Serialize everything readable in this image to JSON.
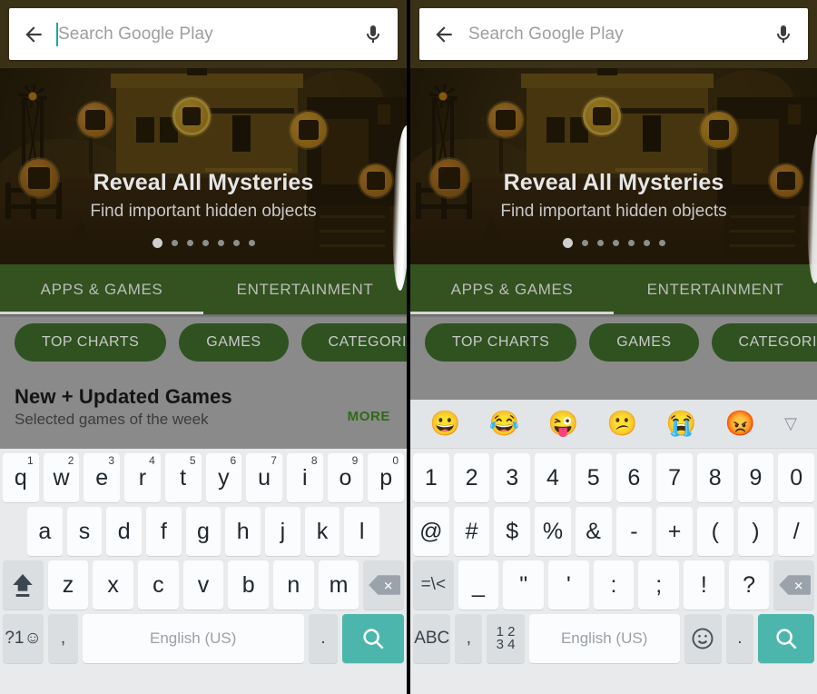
{
  "search": {
    "placeholder": "Search Google Play",
    "back_icon": "back-arrow-icon",
    "mic_icon": "microphone-icon",
    "cursor_color": "#1aa79a"
  },
  "banner": {
    "title": "Reveal All Mysteries",
    "subtitle": "Find important hidden objects",
    "dot_count": 7,
    "active_dot": 1
  },
  "tabs": [
    {
      "label": "APPS & GAMES",
      "active": true
    },
    {
      "label": "ENTERTAINMENT",
      "active": false
    }
  ],
  "chips": [
    {
      "label": "TOP CHARTS"
    },
    {
      "label": "GAMES"
    },
    {
      "label": "CATEGORIES"
    }
  ],
  "section": {
    "title": "New + Updated Games",
    "subtitle": "Selected games of the week",
    "more_label": "MORE"
  },
  "colors": {
    "appbar": "#3a3117",
    "tabbar_green": "#33521f",
    "chip_green": "#2f5220",
    "more_green": "#2e6b17",
    "enter_teal": "#4db6ac",
    "scrim_gray": "#8a8a8a",
    "keyboard_bg": "#e8eaec",
    "key_face": "#fbfcfd",
    "key_func": "#dadee1"
  },
  "keyboard_left": {
    "language_label": "English (US)",
    "rows": [
      [
        {
          "label": "q",
          "hint": "1"
        },
        {
          "label": "w",
          "hint": "2"
        },
        {
          "label": "e",
          "hint": "3"
        },
        {
          "label": "r",
          "hint": "4"
        },
        {
          "label": "t",
          "hint": "5"
        },
        {
          "label": "y",
          "hint": "6"
        },
        {
          "label": "u",
          "hint": "7"
        },
        {
          "label": "i",
          "hint": "8"
        },
        {
          "label": "o",
          "hint": "9"
        },
        {
          "label": "p",
          "hint": "0"
        }
      ],
      [
        {
          "label": "a"
        },
        {
          "label": "s"
        },
        {
          "label": "d"
        },
        {
          "label": "f"
        },
        {
          "label": "g"
        },
        {
          "label": "h"
        },
        {
          "label": "j"
        },
        {
          "label": "k"
        },
        {
          "label": "l"
        }
      ],
      [
        {
          "label": "",
          "icon": "shift-icon",
          "func": true
        },
        {
          "label": "z"
        },
        {
          "label": "x"
        },
        {
          "label": "c"
        },
        {
          "label": "v"
        },
        {
          "label": "b"
        },
        {
          "label": "n"
        },
        {
          "label": "m"
        },
        {
          "label": "",
          "icon": "backspace-icon",
          "func": true
        }
      ],
      [
        {
          "label": "?1☺",
          "func": true
        },
        {
          "label": ",",
          "func": true
        },
        {
          "label": "English (US)",
          "space": true
        },
        {
          "label": ".",
          "func": true
        },
        {
          "label": "",
          "icon": "search-icon",
          "enter": true
        }
      ]
    ]
  },
  "keyboard_right": {
    "language_label": "English (US)",
    "emoji_suggestions": [
      "😀",
      "😂",
      "😜",
      "😕",
      "😭",
      "😡"
    ],
    "collapse_icon": "collapse-triangle-icon",
    "rows": [
      [
        {
          "label": "1"
        },
        {
          "label": "2"
        },
        {
          "label": "3"
        },
        {
          "label": "4"
        },
        {
          "label": "5"
        },
        {
          "label": "6"
        },
        {
          "label": "7"
        },
        {
          "label": "8"
        },
        {
          "label": "9"
        },
        {
          "label": "0"
        }
      ],
      [
        {
          "label": "@"
        },
        {
          "label": "#"
        },
        {
          "label": "$"
        },
        {
          "label": "%"
        },
        {
          "label": "&"
        },
        {
          "label": "-"
        },
        {
          "label": "+"
        },
        {
          "label": "("
        },
        {
          "label": ")"
        },
        {
          "label": "/"
        }
      ],
      [
        {
          "label": "=\\<",
          "func": true
        },
        {
          "label": "_"
        },
        {
          "label": "\""
        },
        {
          "label": "'"
        },
        {
          "label": ":"
        },
        {
          "label": ";"
        },
        {
          "label": "!"
        },
        {
          "label": "?"
        },
        {
          "label": "",
          "icon": "backspace-icon",
          "func": true
        }
      ],
      [
        {
          "label": "ABC",
          "func": true
        },
        {
          "label": ",",
          "func": true
        },
        {
          "label": "1234",
          "func": true
        },
        {
          "label": "English (US)",
          "space": true
        },
        {
          "label": "",
          "icon": "emoji-icon",
          "func": true
        },
        {
          "label": ".",
          "func": true
        },
        {
          "label": "",
          "icon": "search-icon",
          "enter": true
        }
      ]
    ]
  }
}
